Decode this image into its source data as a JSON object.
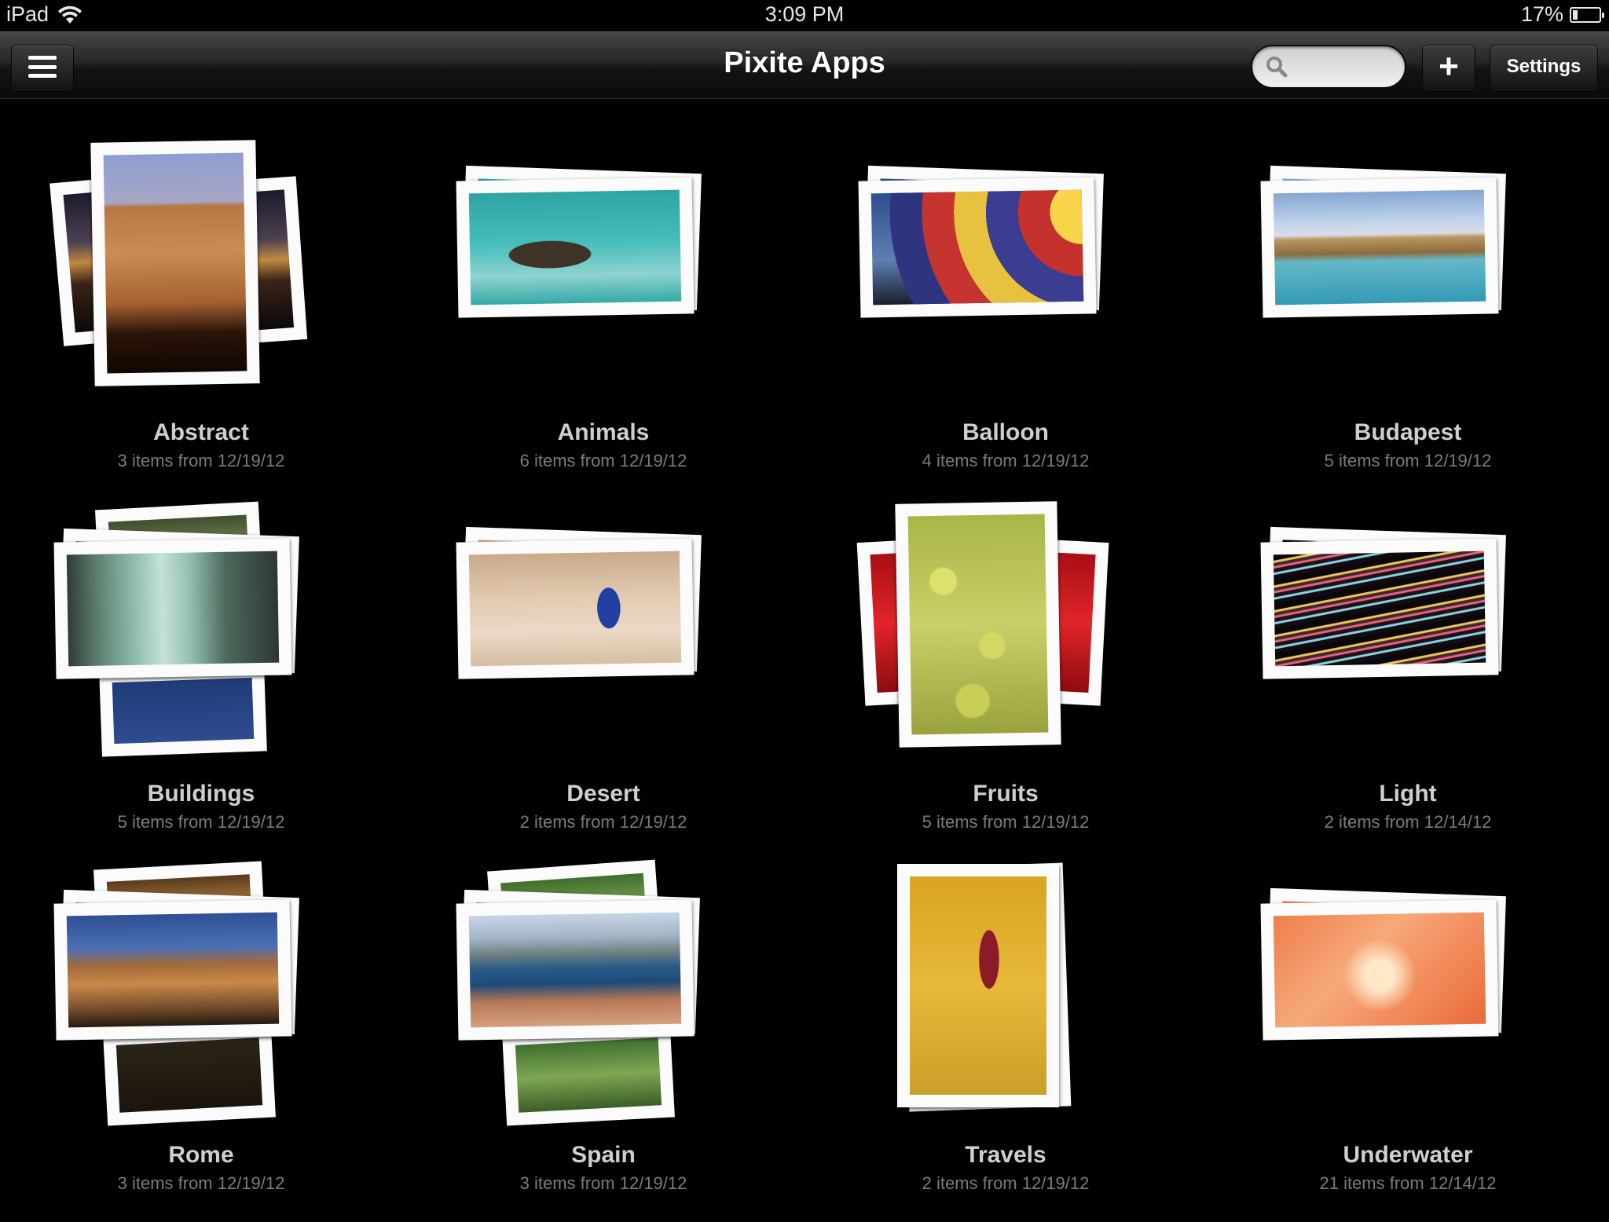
{
  "status_bar": {
    "carrier": "iPad",
    "time": "3:09 PM",
    "battery": "17%",
    "battery_level": 0.17
  },
  "nav": {
    "title": "Pixite Apps",
    "search_placeholder": "",
    "add_label": "+",
    "settings_label": "Settings"
  },
  "albums": [
    {
      "name": "Abstract",
      "meta": "3 items from 12/19/12"
    },
    {
      "name": "Animals",
      "meta": "6 items from 12/19/12"
    },
    {
      "name": "Balloon",
      "meta": "4 items from 12/19/12"
    },
    {
      "name": "Budapest",
      "meta": "5 items from 12/19/12"
    },
    {
      "name": "Buildings",
      "meta": "5 items from 12/19/12"
    },
    {
      "name": "Desert",
      "meta": "2 items from 12/19/12"
    },
    {
      "name": "Fruits",
      "meta": "5 items from 12/19/12"
    },
    {
      "name": "Light",
      "meta": "2 items from 12/14/12"
    },
    {
      "name": "Rome",
      "meta": "3 items from 12/19/12"
    },
    {
      "name": "Spain",
      "meta": "3 items from 12/19/12"
    },
    {
      "name": "Travels",
      "meta": "2 items from 12/19/12"
    },
    {
      "name": "Underwater",
      "meta": "21 items from 12/14/12"
    }
  ]
}
